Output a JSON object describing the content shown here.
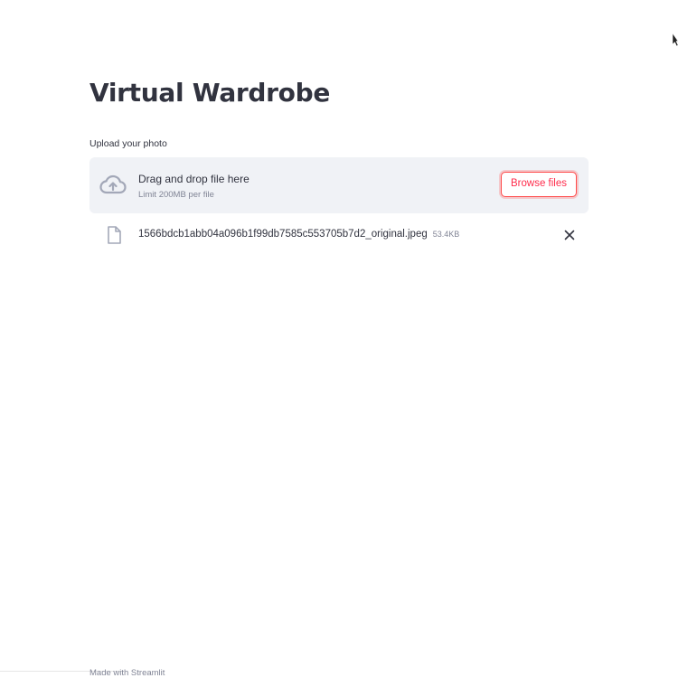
{
  "app": {
    "title": "Virtual Wardrobe"
  },
  "uploader": {
    "label": "Upload your photo",
    "drop_text": "Drag and drop file here",
    "limit_text": "Limit 200MB per file",
    "browse_label": "Browse files",
    "icons": {
      "dropzone": "cloud-upload-icon",
      "file": "file-icon",
      "remove": "close-icon"
    }
  },
  "uploaded_file": {
    "name": "1566bdcb1abb04a096b1f99db7585c553705b7d2_original.jpeg",
    "size": "53.4KB"
  },
  "footer": {
    "text": "Made with Streamlit"
  },
  "colors": {
    "accent": "#ff4b4b",
    "text": "#31333f",
    "muted": "#808495",
    "dropzone_bg": "#f0f2f6"
  }
}
